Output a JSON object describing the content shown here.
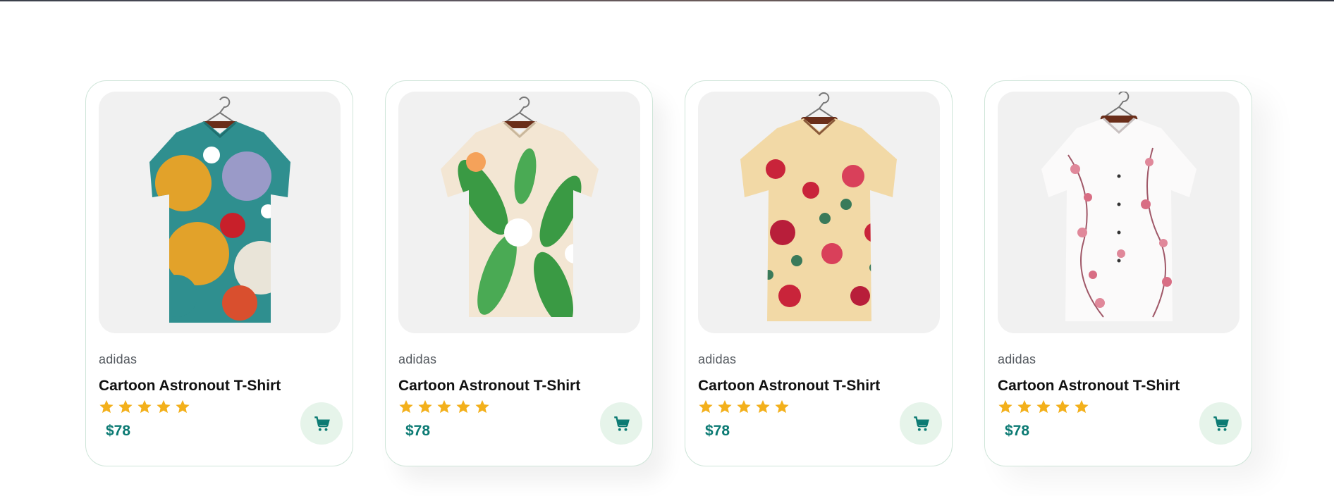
{
  "colors": {
    "accent": "#0b7a73",
    "star": "#f3b01b",
    "cart_bg": "#e6f4ea",
    "card_border": "#cfe5d9",
    "image_bg": "#f1f1f1"
  },
  "products": [
    {
      "brand": "adidas",
      "title": "Cartoon Astronout T-Shirt",
      "rating": 5,
      "price": "$78",
      "image": "cartoon-pattern-shirt",
      "cart_icon": "cart-icon"
    },
    {
      "brand": "adidas",
      "title": "Cartoon Astronout T-Shirt",
      "rating": 5,
      "price": "$78",
      "image": "leaf-pattern-shirt",
      "cart_icon": "cart-icon"
    },
    {
      "brand": "adidas",
      "title": "Cartoon Astronout T-Shirt",
      "rating": 5,
      "price": "$78",
      "image": "floral-pattern-shirt",
      "cart_icon": "cart-icon"
    },
    {
      "brand": "adidas",
      "title": "Cartoon Astronout T-Shirt",
      "rating": 5,
      "price": "$78",
      "image": "blossom-pattern-shirt",
      "cart_icon": "cart-icon"
    }
  ]
}
